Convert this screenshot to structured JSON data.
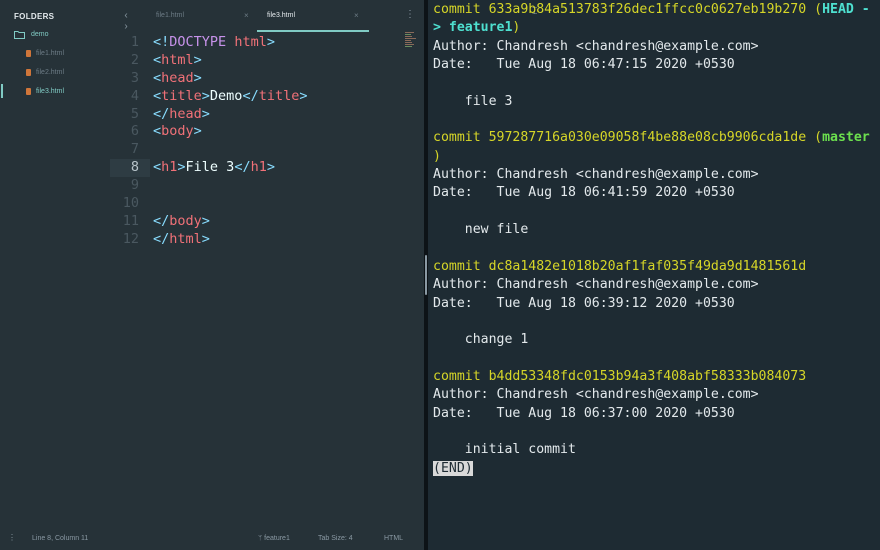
{
  "sidebar": {
    "title": "FOLDERS",
    "folder": "demo",
    "files": [
      "file1.html",
      "file2.html",
      "file3.html"
    ]
  },
  "tabs": [
    {
      "label": "file1.html",
      "close": "×"
    },
    {
      "label": "file3.html",
      "close": "×"
    }
  ],
  "code_lines": [
    {
      "n": "1",
      "parts": [
        [
          "<!",
          "p"
        ],
        [
          "DOCTYPE",
          "d"
        ],
        [
          " ",
          "x"
        ],
        [
          "html",
          "t"
        ],
        [
          ">",
          "p"
        ]
      ]
    },
    {
      "n": "2",
      "parts": [
        [
          "<",
          "p"
        ],
        [
          "html",
          "t"
        ],
        [
          ">",
          "p"
        ]
      ]
    },
    {
      "n": "3",
      "parts": [
        [
          "<",
          "p"
        ],
        [
          "head",
          "t"
        ],
        [
          ">",
          "p"
        ]
      ]
    },
    {
      "n": "4",
      "parts": [
        [
          "<",
          "p"
        ],
        [
          "title",
          "t"
        ],
        [
          ">",
          "p"
        ],
        [
          "Demo",
          "x"
        ],
        [
          "</",
          "p"
        ],
        [
          "title",
          "t"
        ],
        [
          ">",
          "p"
        ]
      ]
    },
    {
      "n": "5",
      "parts": [
        [
          "</",
          "p"
        ],
        [
          "head",
          "t"
        ],
        [
          ">",
          "p"
        ]
      ]
    },
    {
      "n": "6",
      "parts": [
        [
          "<",
          "p"
        ],
        [
          "body",
          "t"
        ],
        [
          ">",
          "p"
        ]
      ]
    },
    {
      "n": "7",
      "parts": []
    },
    {
      "n": "8",
      "parts": [
        [
          "<",
          "p"
        ],
        [
          "h1",
          "t"
        ],
        [
          ">",
          "p"
        ],
        [
          "File 3",
          "x"
        ],
        [
          "</",
          "p"
        ],
        [
          "h1",
          "t"
        ],
        [
          ">",
          "p"
        ]
      ],
      "current": true
    },
    {
      "n": "9",
      "parts": []
    },
    {
      "n": "10",
      "parts": []
    },
    {
      "n": "11",
      "parts": [
        [
          "</",
          "p"
        ],
        [
          "body",
          "t"
        ],
        [
          ">",
          "p"
        ]
      ]
    },
    {
      "n": "12",
      "parts": [
        [
          "</",
          "p"
        ],
        [
          "html",
          "t"
        ],
        [
          ">",
          "p"
        ]
      ]
    }
  ],
  "status": {
    "position": "Line 8, Column 11",
    "branch": "feature1",
    "tab_size": "Tab Size: 4",
    "syntax": "HTML"
  },
  "terminal_lines": [
    [
      [
        "commit 633a9b84a513783f26dec1ffcc0c0627eb19b270 ",
        "commit"
      ],
      [
        "(",
        "paren"
      ],
      [
        "HEAD -",
        "ref"
      ]
    ],
    [
      [
        "> feature1",
        "ref"
      ],
      [
        ")",
        "paren"
      ]
    ],
    [
      [
        "Author: Chandresh <chandresh@example.com>",
        "text"
      ]
    ],
    [
      [
        "Date:   Tue Aug 18 06:47:15 2020 +0530",
        "text"
      ]
    ],
    [],
    [
      [
        "    file 3",
        "text"
      ]
    ],
    [],
    [
      [
        "commit 597287716a030e09058f4be88e08cb9906cda1de ",
        "commit"
      ],
      [
        "(",
        "paren"
      ],
      [
        "master",
        "br"
      ]
    ],
    [
      [
        ")",
        "paren"
      ]
    ],
    [
      [
        "Author: Chandresh <chandresh@example.com>",
        "text"
      ]
    ],
    [
      [
        "Date:   Tue Aug 18 06:41:59 2020 +0530",
        "text"
      ]
    ],
    [],
    [
      [
        "    new file",
        "text"
      ]
    ],
    [],
    [
      [
        "commit dc8a1482e1018b20af1faf035f49da9d1481561d",
        "commit"
      ]
    ],
    [
      [
        "Author: Chandresh <chandresh@example.com>",
        "text"
      ]
    ],
    [
      [
        "Date:   Tue Aug 18 06:39:12 2020 +0530",
        "text"
      ]
    ],
    [],
    [
      [
        "    change 1",
        "text"
      ]
    ],
    [],
    [
      [
        "commit b4dd53348fdc0153b94a3f408abf58333b084073",
        "commit"
      ]
    ],
    [
      [
        "Author: Chandresh <chandresh@example.com>",
        "text"
      ]
    ],
    [
      [
        "Date:   Tue Aug 18 06:37:00 2020 +0530",
        "text"
      ]
    ],
    [],
    [
      [
        "    initial commit",
        "text"
      ]
    ],
    [
      [
        "(END)",
        "end"
      ]
    ]
  ],
  "colors": {
    "accent": "#80cbc4",
    "commit_hash": "#d6d628",
    "ref_head": "#4ee0d0",
    "ref_branch": "#6ce04e"
  },
  "icons": [
    "folder-icon",
    "html-file-icon",
    "branch-icon",
    "chevron-left-icon",
    "chevron-right-icon",
    "more-vertical-icon"
  ]
}
